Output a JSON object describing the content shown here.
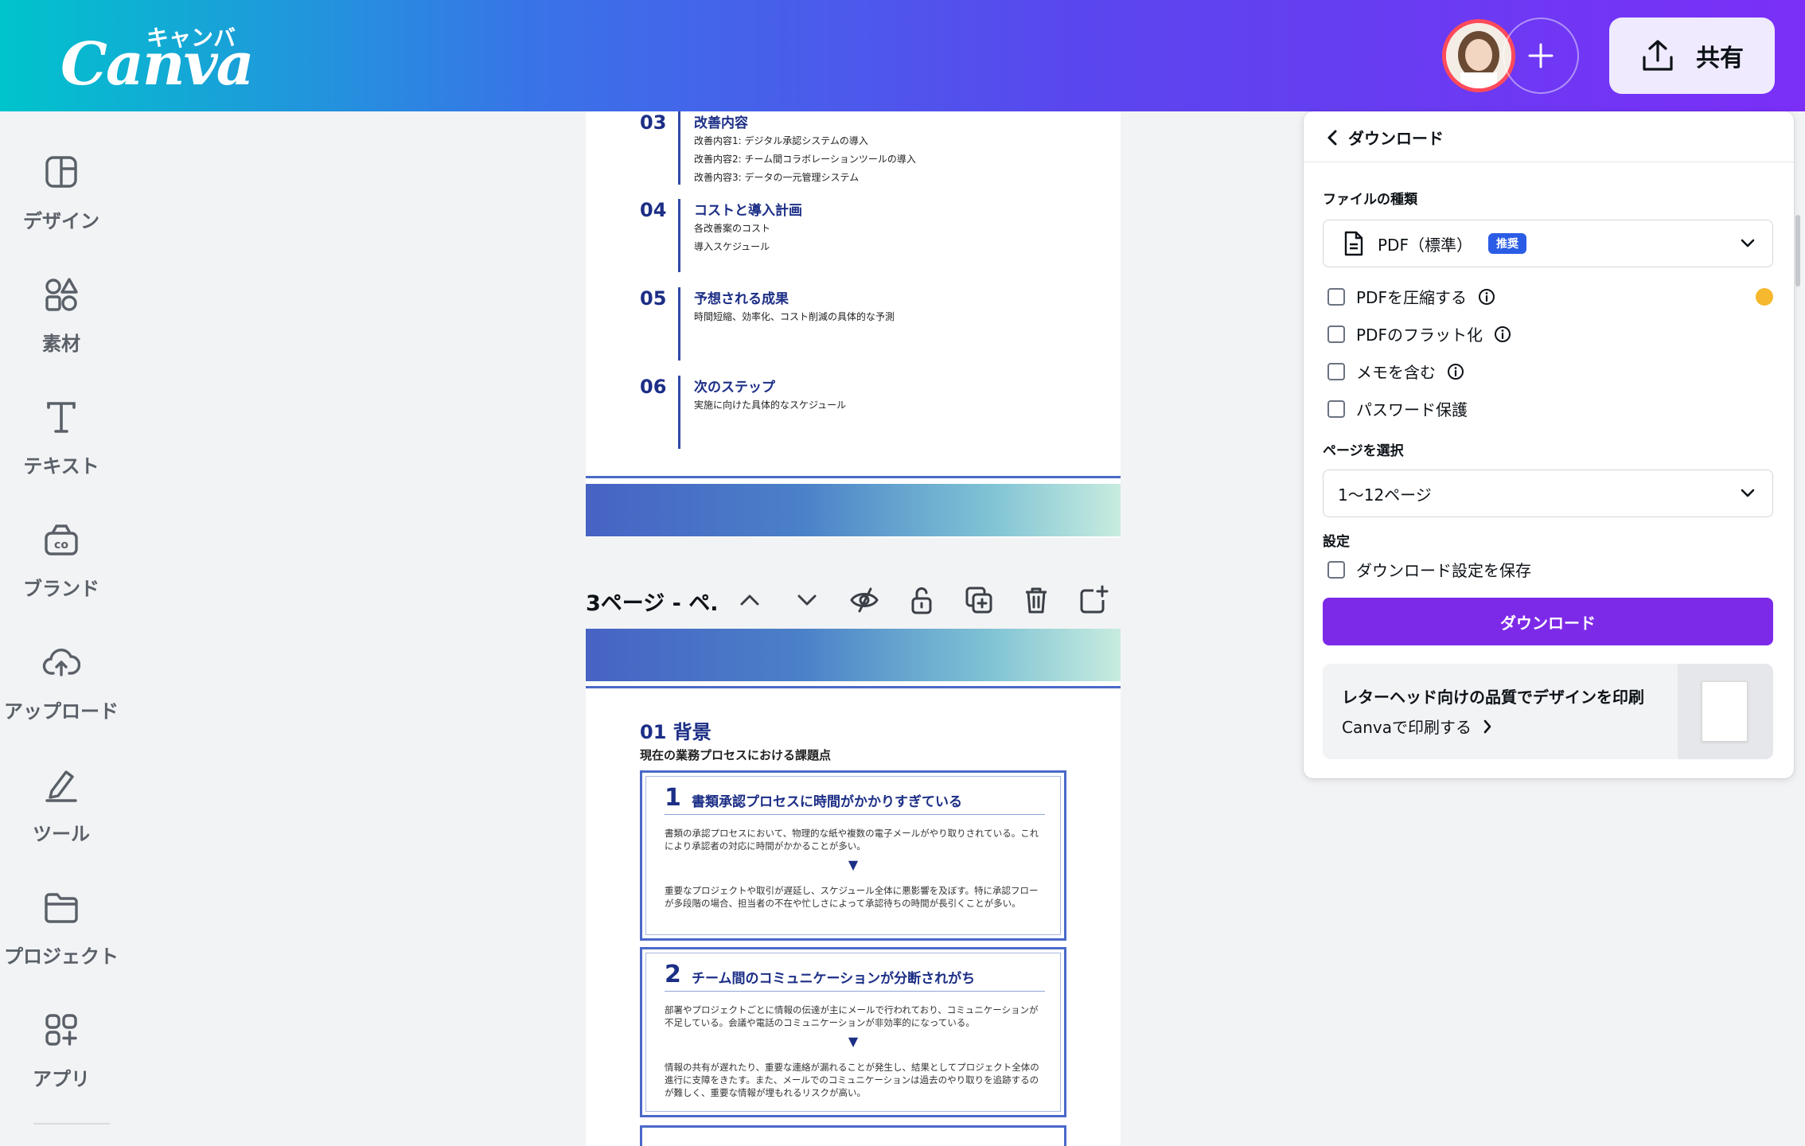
{
  "header": {
    "logo_text": "Canva",
    "logo_kana": "キャンバ",
    "share_label": "共有"
  },
  "sidebar": {
    "items": [
      {
        "label": "デザイン",
        "icon": "design-icon"
      },
      {
        "label": "素材",
        "icon": "elements-icon"
      },
      {
        "label": "テキスト",
        "icon": "text-icon"
      },
      {
        "label": "ブランド",
        "icon": "brand-icon"
      },
      {
        "label": "アップロード",
        "icon": "upload-cloud-icon"
      },
      {
        "label": "ツール",
        "icon": "tools-icon"
      },
      {
        "label": "プロジェクト",
        "icon": "folder-icon"
      },
      {
        "label": "アプリ",
        "icon": "apps-icon"
      }
    ]
  },
  "page2": {
    "toc": [
      {
        "num": "03",
        "title": "改善内容",
        "subs": [
          "改善内容1: デジタル承認システムの導入",
          "改善内容2: チーム間コラボレーションツールの導入",
          "改善内容3: データの一元管理システム"
        ]
      },
      {
        "num": "04",
        "title": "コストと導入計画",
        "subs": [
          "各改善案のコスト",
          "導入スケジュール"
        ]
      },
      {
        "num": "05",
        "title": "予想される成果",
        "subs": [
          "時間短縮、効率化、コスト削減の具体的な予測"
        ]
      },
      {
        "num": "06",
        "title": "次のステップ",
        "subs": [
          "実施に向けた具体的なスケジュール"
        ]
      }
    ]
  },
  "page_toolbar": {
    "label": "3ページ - ペ."
  },
  "page3": {
    "section_title": "01 背景",
    "section_sub": "現在の業務プロセスにおける課題点",
    "cards": [
      {
        "num": "1",
        "title": "書類承認プロセスに時間がかかりすぎている",
        "text1": "書類の承認プロセスにおいて、物理的な紙や複数の電子メールがやり取りされている。これにより承認者の対応に時間がかかることが多い。",
        "arrow": "▼",
        "text2": "重要なプロジェクトや取引が遅延し、スケジュール全体に悪影響を及ぼす。特に承認フローが多段階の場合、担当者の不在や忙しさによって承認待ちの時間が長引くことが多い。"
      },
      {
        "num": "2",
        "title": "チーム間のコミュニケーションが分断されがち",
        "text1": "部署やプロジェクトごとに情報の伝達が主にメールで行われており、コミュニケーションが不足している。会議や電話のコミュニケーションが非効率的になっている。",
        "arrow": "▼",
        "text2": "情報の共有が遅れたり、重要な連絡が漏れることが発生し、結果としてプロジェクト全体の進行に支障をきたす。また、メールでのコミュニケーションは過去のやり取りを追跡するのが難しく、重要な情報が埋もれるリスクが高い。"
      }
    ]
  },
  "download_panel": {
    "back_label": "ダウンロード",
    "file_type_label": "ファイルの種類",
    "file_type_value": "PDF（標準）",
    "file_type_badge": "推奨",
    "options": [
      {
        "label": "PDFを圧縮する",
        "info": true,
        "checked": false
      },
      {
        "label": "PDFのフラット化",
        "info": true,
        "checked": false
      },
      {
        "label": "メモを含む",
        "info": true,
        "checked": false
      },
      {
        "label": "パスワード保護",
        "info": false,
        "checked": false
      }
    ],
    "page_select_label": "ページを選択",
    "page_select_value": "1〜12ページ",
    "settings_label": "設定",
    "save_settings_label": "ダウンロード設定を保存",
    "download_button": "ダウンロード",
    "promo_title": "レターヘッド向けの品質でデザインを印刷",
    "promo_link": "Canvaで印刷する"
  },
  "colors": {
    "accent": "#7d2ae8",
    "heading_navy": "#1c2e86",
    "badge_blue": "#2b5ce6"
  }
}
